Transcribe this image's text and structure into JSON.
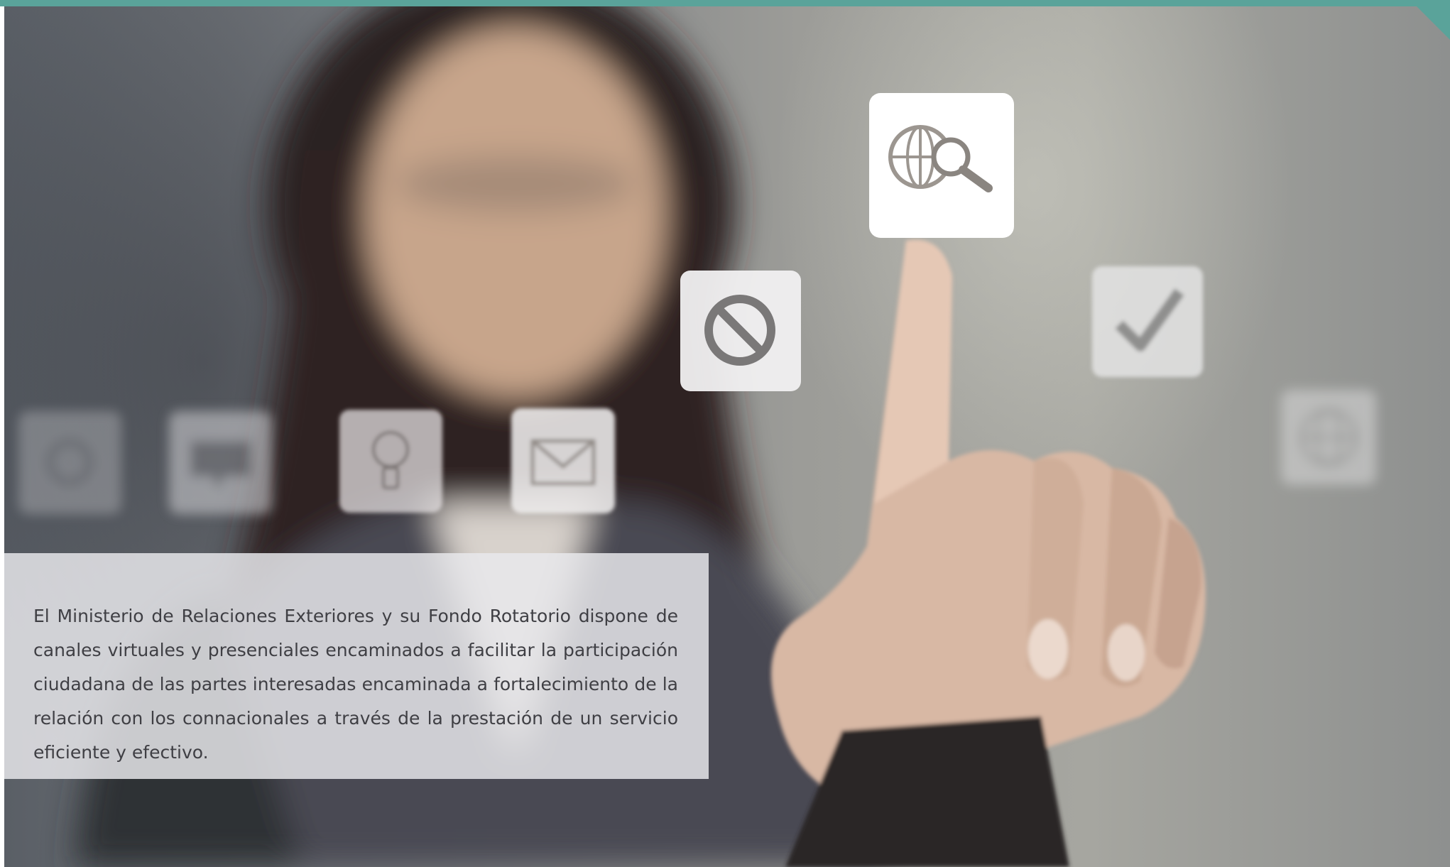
{
  "caption": {
    "text": "El Ministerio de Relaciones Exteriores y su Fondo Rotatorio dispone de canales virtuales y presenciales encaminados a facilitar la participación ciudadana de las partes interesadas encaminada a fortalecimiento de la relación con los connacionales a través de la prestación de un servicio eficiente y efectivo."
  },
  "photo": {
    "subject": "woman pointing at floating app icons",
    "icons": [
      "gear-icon",
      "chat-icon",
      "lightbulb-icon",
      "mail-icon",
      "prohibited-icon",
      "globe-search-icon",
      "checkmark-icon",
      "globe-icon"
    ]
  },
  "colors": {
    "accent": "#5aa39a",
    "caption_text": "#3f3f44",
    "panel": "#e8e8ec"
  }
}
